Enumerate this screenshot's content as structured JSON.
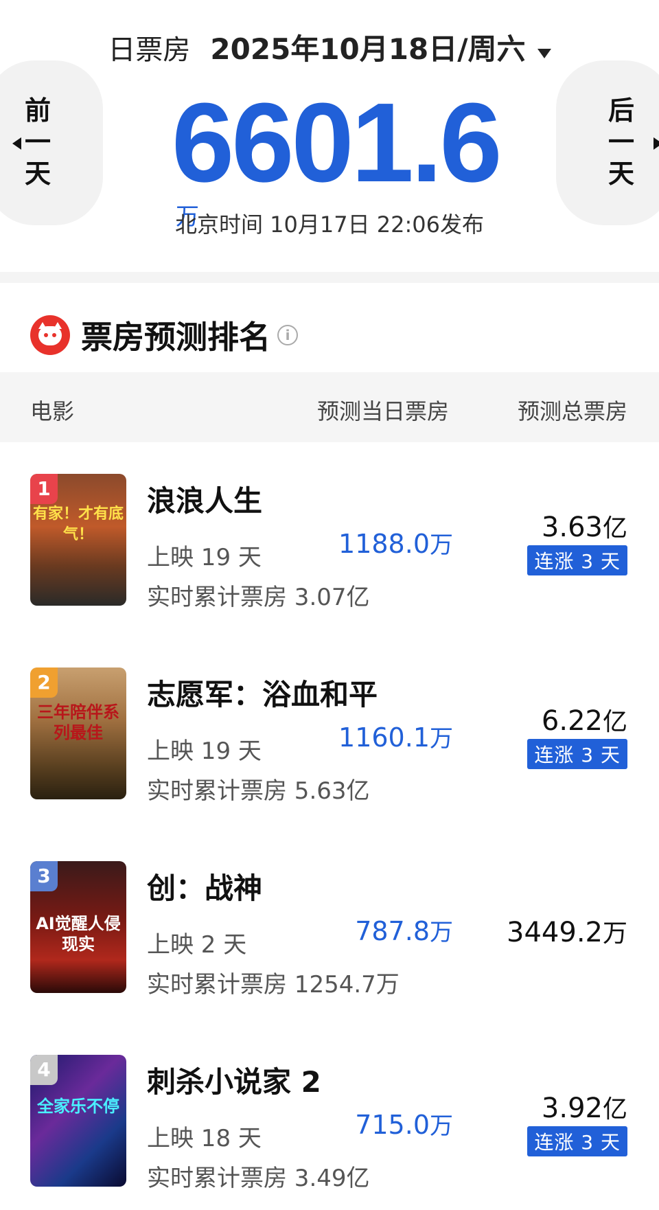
{
  "header": {
    "label": "日票房",
    "date": "2025年10月18日/周六",
    "prev_label": "前一天",
    "next_label": "后一天",
    "total_value": "6601.6",
    "total_unit": "万",
    "publish_info": "北京时间 10月17日 22:06发布"
  },
  "section": {
    "title": "票房预测排名",
    "info_icon": "i"
  },
  "columns": {
    "movie": "电影",
    "predicted_daily": "预测当日票房",
    "predicted_total": "预测总票房"
  },
  "colors": {
    "accent": "#2160d8",
    "rank1": "#e8434b",
    "rank2": "#f0a030",
    "rank3": "#5a7fd0",
    "rank4": "#c8c8c8"
  },
  "movies": [
    {
      "rank": "1",
      "title": "浪浪人生",
      "days": "上映 19 天",
      "cumulative": "实时累计票房 3.07亿",
      "predicted_daily": "1188.0",
      "predicted_daily_unit": "万",
      "predicted_total": "3.63",
      "predicted_total_unit": "亿",
      "streak": "连涨 3 天",
      "poster_text": "有家！才有底气！"
    },
    {
      "rank": "2",
      "title": "志愿军：浴血和平",
      "days": "上映 19 天",
      "cumulative": "实时累计票房 5.63亿",
      "predicted_daily": "1160.1",
      "predicted_daily_unit": "万",
      "predicted_total": "6.22",
      "predicted_total_unit": "亿",
      "streak": "连涨 3 天",
      "poster_text": "三年陪伴系列最佳"
    },
    {
      "rank": "3",
      "title": "创：战神",
      "days": "上映 2 天",
      "cumulative": "实时累计票房 1254.7万",
      "predicted_daily": "787.8",
      "predicted_daily_unit": "万",
      "predicted_total": "3449.2",
      "predicted_total_unit": "万",
      "streak": "",
      "poster_text": "AI觉醒人侵现实"
    },
    {
      "rank": "4",
      "title": "刺杀小说家 2",
      "days": "上映 18 天",
      "cumulative": "实时累计票房 3.49亿",
      "predicted_daily": "715.0",
      "predicted_daily_unit": "万",
      "predicted_total": "3.92",
      "predicted_total_unit": "亿",
      "streak": "连涨 3 天",
      "poster_text": "全家乐不停"
    }
  ]
}
